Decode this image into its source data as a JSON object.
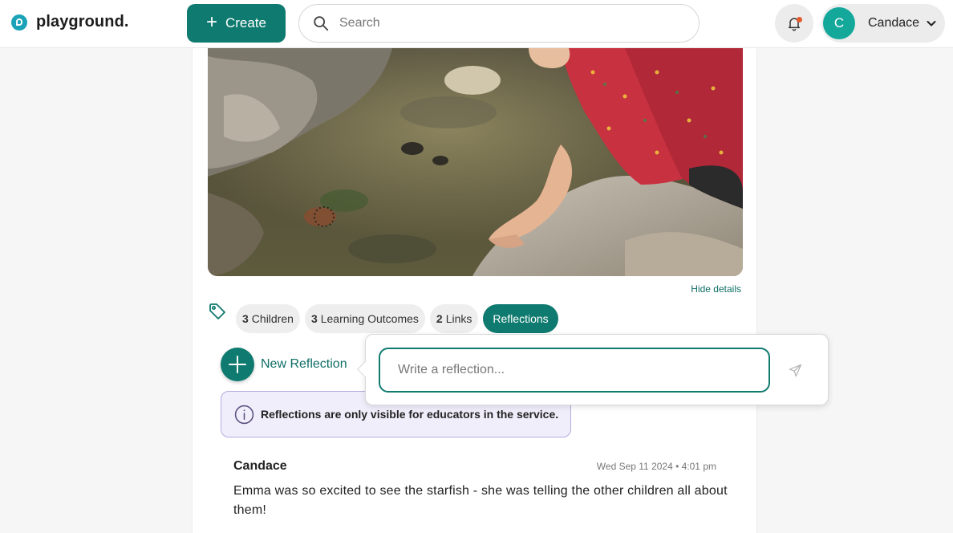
{
  "app": {
    "name": "playground."
  },
  "header": {
    "create_label": "Create",
    "search_placeholder": "Search",
    "user": {
      "initial": "C",
      "name": "Candace"
    }
  },
  "post": {
    "hide_details": "Hide details",
    "chips": [
      {
        "count": "3",
        "label": "Children"
      },
      {
        "count": "3",
        "label": "Learning Outcomes"
      },
      {
        "count": "2",
        "label": "Links"
      },
      {
        "count": "",
        "label": "Reflections",
        "active": true
      }
    ],
    "new_reflection_label": "New Reflection",
    "reflection_placeholder": "Write a reflection...",
    "notice": "Reflections are only visible for educators in the service.",
    "reflections": [
      {
        "author": "Candace",
        "timestamp": "Wed Sep 11 2024 • 4:01 pm",
        "text": "Emma was so excited to see the starfish - she was telling the other children all about them!"
      }
    ]
  },
  "colors": {
    "brand": "#0f7a6f",
    "logo": "#1aa3b8",
    "avatar": "#14a89a",
    "notice_bg": "#f1eefb",
    "notice_border": "#b7aae0"
  }
}
